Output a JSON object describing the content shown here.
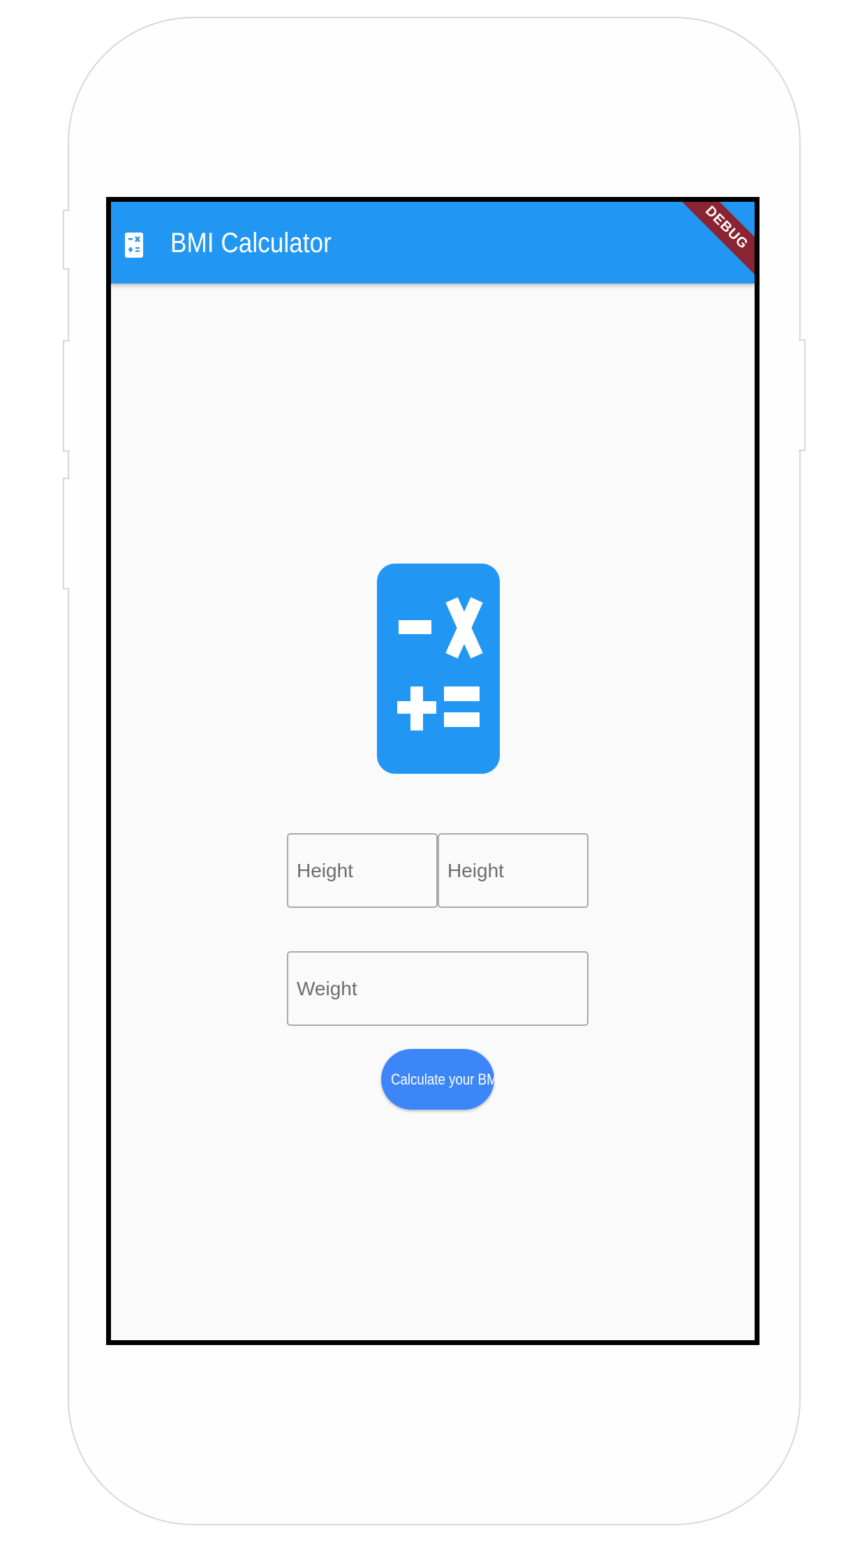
{
  "app": {
    "title": "BMI Calculator",
    "debug_label": "DEBUG",
    "theme_color": "#2196f3",
    "button_color": "#3d86fa"
  },
  "icons": {
    "appbar": "calculator-icon",
    "logo": "calculator-icon"
  },
  "form": {
    "height_feet_placeholder": "Height",
    "height_inches_placeholder": "Height",
    "weight_placeholder": "Weight",
    "submit_label": "Calculate your BMI"
  }
}
